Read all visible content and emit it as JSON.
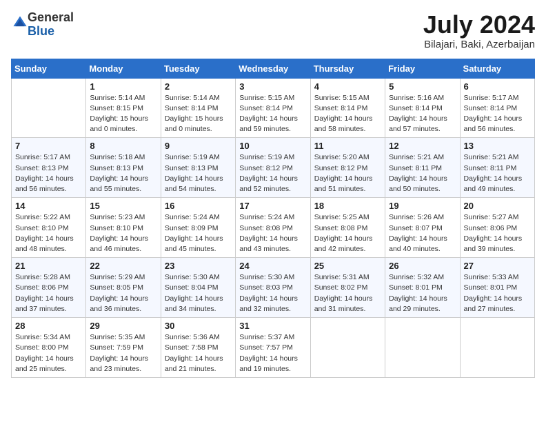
{
  "logo": {
    "general": "General",
    "blue": "Blue"
  },
  "title": "July 2024",
  "subtitle": "Bilajari, Baki, Azerbaijan",
  "days_header": [
    "Sunday",
    "Monday",
    "Tuesday",
    "Wednesday",
    "Thursday",
    "Friday",
    "Saturday"
  ],
  "weeks": [
    [
      {
        "day": "",
        "info": ""
      },
      {
        "day": "1",
        "info": "Sunrise: 5:14 AM\nSunset: 8:15 PM\nDaylight: 15 hours\nand 0 minutes."
      },
      {
        "day": "2",
        "info": "Sunrise: 5:14 AM\nSunset: 8:14 PM\nDaylight: 15 hours\nand 0 minutes."
      },
      {
        "day": "3",
        "info": "Sunrise: 5:15 AM\nSunset: 8:14 PM\nDaylight: 14 hours\nand 59 minutes."
      },
      {
        "day": "4",
        "info": "Sunrise: 5:15 AM\nSunset: 8:14 PM\nDaylight: 14 hours\nand 58 minutes."
      },
      {
        "day": "5",
        "info": "Sunrise: 5:16 AM\nSunset: 8:14 PM\nDaylight: 14 hours\nand 57 minutes."
      },
      {
        "day": "6",
        "info": "Sunrise: 5:17 AM\nSunset: 8:14 PM\nDaylight: 14 hours\nand 56 minutes."
      }
    ],
    [
      {
        "day": "7",
        "info": "Sunrise: 5:17 AM\nSunset: 8:13 PM\nDaylight: 14 hours\nand 56 minutes."
      },
      {
        "day": "8",
        "info": "Sunrise: 5:18 AM\nSunset: 8:13 PM\nDaylight: 14 hours\nand 55 minutes."
      },
      {
        "day": "9",
        "info": "Sunrise: 5:19 AM\nSunset: 8:13 PM\nDaylight: 14 hours\nand 54 minutes."
      },
      {
        "day": "10",
        "info": "Sunrise: 5:19 AM\nSunset: 8:12 PM\nDaylight: 14 hours\nand 52 minutes."
      },
      {
        "day": "11",
        "info": "Sunrise: 5:20 AM\nSunset: 8:12 PM\nDaylight: 14 hours\nand 51 minutes."
      },
      {
        "day": "12",
        "info": "Sunrise: 5:21 AM\nSunset: 8:11 PM\nDaylight: 14 hours\nand 50 minutes."
      },
      {
        "day": "13",
        "info": "Sunrise: 5:21 AM\nSunset: 8:11 PM\nDaylight: 14 hours\nand 49 minutes."
      }
    ],
    [
      {
        "day": "14",
        "info": "Sunrise: 5:22 AM\nSunset: 8:10 PM\nDaylight: 14 hours\nand 48 minutes."
      },
      {
        "day": "15",
        "info": "Sunrise: 5:23 AM\nSunset: 8:10 PM\nDaylight: 14 hours\nand 46 minutes."
      },
      {
        "day": "16",
        "info": "Sunrise: 5:24 AM\nSunset: 8:09 PM\nDaylight: 14 hours\nand 45 minutes."
      },
      {
        "day": "17",
        "info": "Sunrise: 5:24 AM\nSunset: 8:08 PM\nDaylight: 14 hours\nand 43 minutes."
      },
      {
        "day": "18",
        "info": "Sunrise: 5:25 AM\nSunset: 8:08 PM\nDaylight: 14 hours\nand 42 minutes."
      },
      {
        "day": "19",
        "info": "Sunrise: 5:26 AM\nSunset: 8:07 PM\nDaylight: 14 hours\nand 40 minutes."
      },
      {
        "day": "20",
        "info": "Sunrise: 5:27 AM\nSunset: 8:06 PM\nDaylight: 14 hours\nand 39 minutes."
      }
    ],
    [
      {
        "day": "21",
        "info": "Sunrise: 5:28 AM\nSunset: 8:06 PM\nDaylight: 14 hours\nand 37 minutes."
      },
      {
        "day": "22",
        "info": "Sunrise: 5:29 AM\nSunset: 8:05 PM\nDaylight: 14 hours\nand 36 minutes."
      },
      {
        "day": "23",
        "info": "Sunrise: 5:30 AM\nSunset: 8:04 PM\nDaylight: 14 hours\nand 34 minutes."
      },
      {
        "day": "24",
        "info": "Sunrise: 5:30 AM\nSunset: 8:03 PM\nDaylight: 14 hours\nand 32 minutes."
      },
      {
        "day": "25",
        "info": "Sunrise: 5:31 AM\nSunset: 8:02 PM\nDaylight: 14 hours\nand 31 minutes."
      },
      {
        "day": "26",
        "info": "Sunrise: 5:32 AM\nSunset: 8:01 PM\nDaylight: 14 hours\nand 29 minutes."
      },
      {
        "day": "27",
        "info": "Sunrise: 5:33 AM\nSunset: 8:01 PM\nDaylight: 14 hours\nand 27 minutes."
      }
    ],
    [
      {
        "day": "28",
        "info": "Sunrise: 5:34 AM\nSunset: 8:00 PM\nDaylight: 14 hours\nand 25 minutes."
      },
      {
        "day": "29",
        "info": "Sunrise: 5:35 AM\nSunset: 7:59 PM\nDaylight: 14 hours\nand 23 minutes."
      },
      {
        "day": "30",
        "info": "Sunrise: 5:36 AM\nSunset: 7:58 PM\nDaylight: 14 hours\nand 21 minutes."
      },
      {
        "day": "31",
        "info": "Sunrise: 5:37 AM\nSunset: 7:57 PM\nDaylight: 14 hours\nand 19 minutes."
      },
      {
        "day": "",
        "info": ""
      },
      {
        "day": "",
        "info": ""
      },
      {
        "day": "",
        "info": ""
      }
    ]
  ]
}
